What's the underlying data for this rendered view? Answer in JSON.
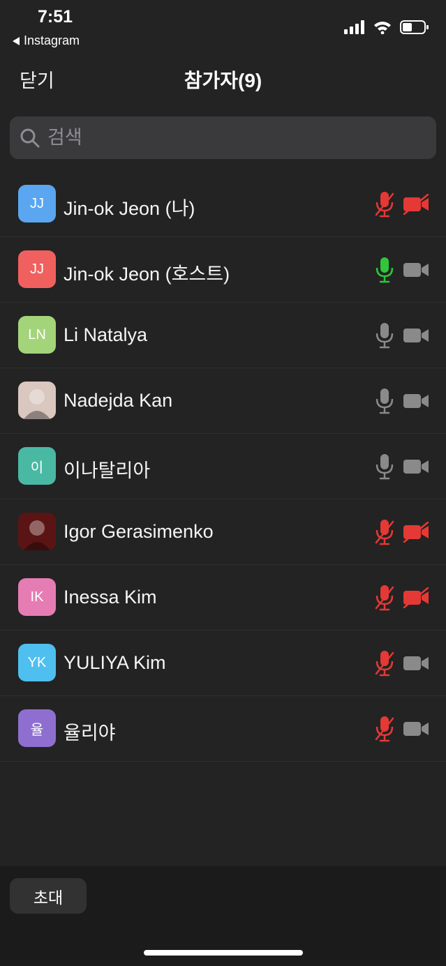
{
  "status_bar": {
    "time": "7:51",
    "back_app": "Instagram",
    "icons": [
      "signal-icon",
      "wifi-icon",
      "battery-icon"
    ]
  },
  "header": {
    "close_label": "닫기",
    "title": "참가자(9)"
  },
  "search": {
    "placeholder": "검색",
    "value": ""
  },
  "colors": {
    "muted_red": "#e53935",
    "unmuted_green": "#31c53a",
    "neutral_icon": "#8a8a8a"
  },
  "participants": [
    {
      "name": "Jin-ok Jeon (나)",
      "initials": "JJ",
      "avatar_color": "#5aa6f0",
      "avatar_type": "initials",
      "mic": "muted",
      "video": "off"
    },
    {
      "name": "Jin-ok Jeon (호스트)",
      "initials": "JJ",
      "avatar_color": "#f0605e",
      "avatar_type": "initials",
      "mic": "active",
      "video": "on"
    },
    {
      "name": "Li Natalya",
      "initials": "LN",
      "avatar_color": "#a3d47a",
      "avatar_type": "initials",
      "mic": "on",
      "video": "on"
    },
    {
      "name": "Nadejda Kan",
      "initials": "",
      "avatar_color": "#d9c7c0",
      "avatar_type": "photo",
      "mic": "on",
      "video": "on"
    },
    {
      "name": "이나탈리아",
      "initials": "이",
      "avatar_color": "#49b9a4",
      "avatar_type": "initials",
      "mic": "on",
      "video": "on"
    },
    {
      "name": "Igor Gerasimenko",
      "initials": "",
      "avatar_color": "#5a1414",
      "avatar_type": "photo",
      "mic": "muted",
      "video": "off"
    },
    {
      "name": "Inessa Kim",
      "initials": "IK",
      "avatar_color": "#e57cb4",
      "avatar_type": "initials",
      "mic": "muted",
      "video": "off"
    },
    {
      "name": "YULIYA Kim",
      "initials": "YK",
      "avatar_color": "#4fbfef",
      "avatar_type": "initials",
      "mic": "muted",
      "video": "on"
    },
    {
      "name": "율리야",
      "initials": "율",
      "avatar_color": "#8e6fd0",
      "avatar_type": "initials",
      "mic": "muted",
      "video": "on"
    }
  ],
  "footer": {
    "invite_label": "초대"
  }
}
